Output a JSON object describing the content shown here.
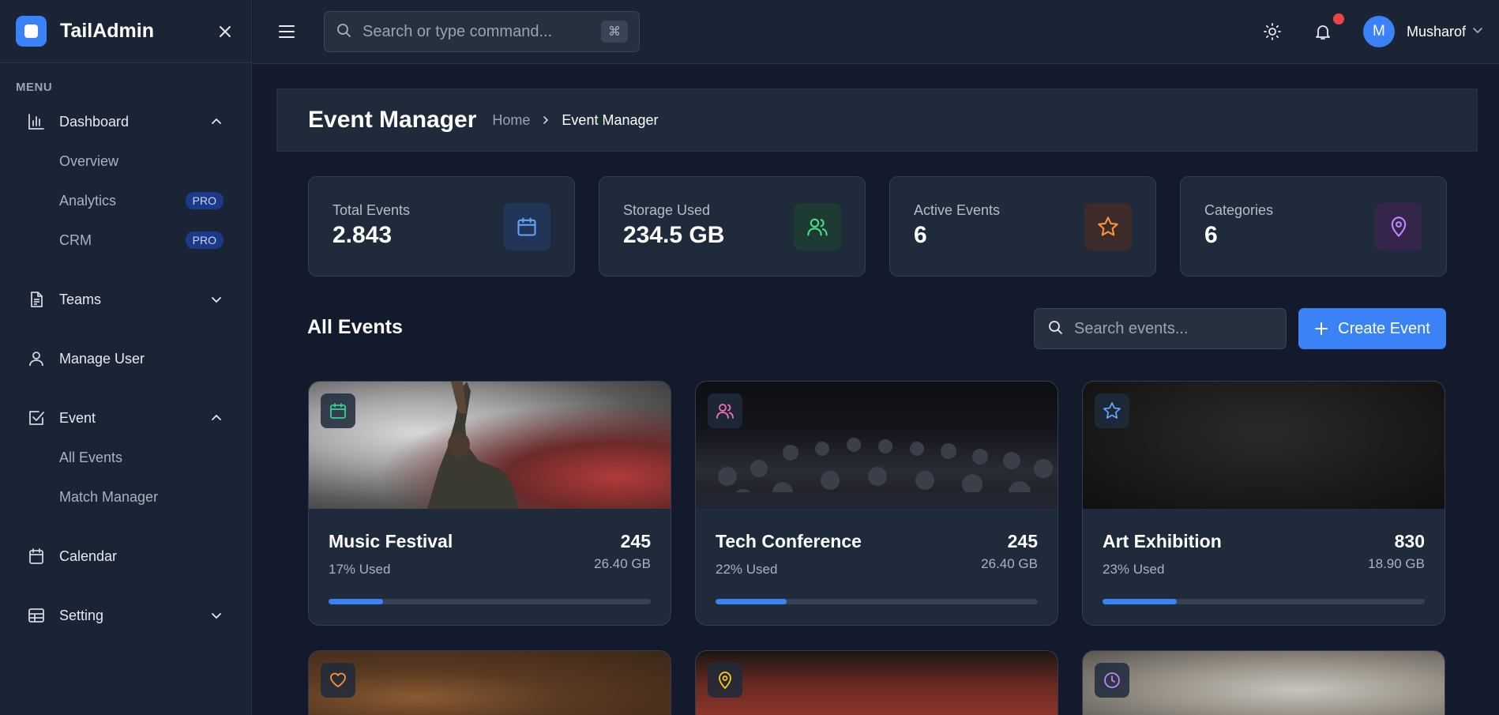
{
  "app": {
    "name": "TailAdmin"
  },
  "sidebar": {
    "menu_label": "MENU",
    "dashboard": {
      "label": "Dashboard",
      "icon": "bar-chart-icon",
      "subitems": [
        {
          "label": "Overview"
        },
        {
          "label": "Analytics",
          "badge": "PRO"
        },
        {
          "label": "CRM",
          "badge": "PRO"
        }
      ]
    },
    "teams": {
      "label": "Teams",
      "icon": "document-icon"
    },
    "manage_user": {
      "label": "Manage User",
      "icon": "user-icon"
    },
    "event": {
      "label": "Event",
      "icon": "checkbox-icon",
      "subitems": [
        {
          "label": "All Events"
        },
        {
          "label": "Match Manager"
        }
      ]
    },
    "calendar": {
      "label": "Calendar",
      "icon": "calendar-icon"
    },
    "setting": {
      "label": "Setting",
      "icon": "table-icon"
    }
  },
  "topbar": {
    "search_placeholder": "Search or type command...",
    "search_shortcut": "⌘",
    "user": {
      "initial": "M",
      "name": "Musharof"
    }
  },
  "page": {
    "title": "Event Manager",
    "breadcrumb": {
      "home": "Home",
      "current": "Event Manager"
    }
  },
  "stats": [
    {
      "label": "Total Events",
      "value": "2.843",
      "icon": "calendar-icon",
      "color": "#3b82f6"
    },
    {
      "label": "Storage Used",
      "value": "234.5 GB",
      "icon": "users-icon",
      "color": "#22c55e"
    },
    {
      "label": "Active Events",
      "value": "6",
      "icon": "star-icon",
      "color": "#f97316"
    },
    {
      "label": "Categories",
      "value": "6",
      "icon": "map-pin-icon",
      "color": "#a855f7"
    }
  ],
  "events_section": {
    "title": "All Events",
    "search_placeholder": "Search events...",
    "create_label": "Create Event"
  },
  "events": [
    {
      "name": "Music Festival",
      "used": "17% Used",
      "used_pct": 17,
      "count": "245",
      "size": "26.40 GB",
      "icon": "calendar-icon"
    },
    {
      "name": "Tech Conference",
      "used": "22% Used",
      "used_pct": 22,
      "count": "245",
      "size": "26.40 GB",
      "icon": "users-icon"
    },
    {
      "name": "Art Exhibition",
      "used": "23% Used",
      "used_pct": 23,
      "count": "830",
      "size": "18.90 GB",
      "icon": "star-icon"
    }
  ],
  "events_partial": [
    {
      "icon": "heart-icon"
    },
    {
      "icon": "map-pin-icon"
    },
    {
      "icon": "clock-icon"
    }
  ]
}
